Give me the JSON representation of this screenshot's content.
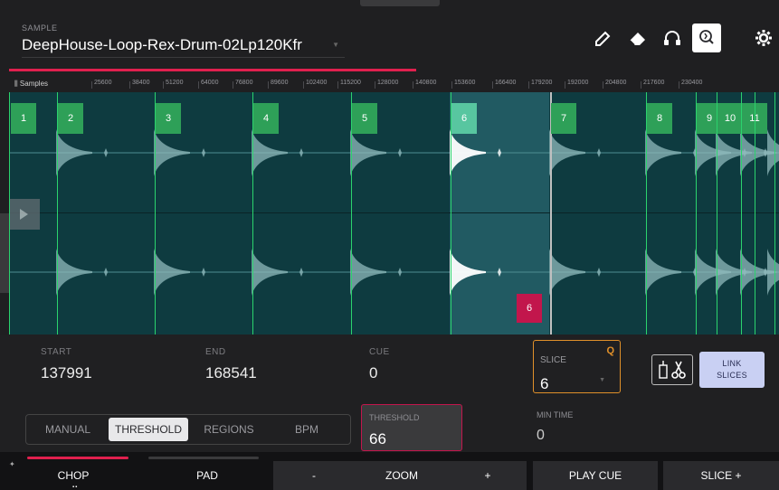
{
  "header": {
    "caption": "SAMPLE",
    "sample_name": "DeepHouse-Loop-Rex-Drum-02Lp120Kfr",
    "tools": [
      "pencil-icon",
      "eraser-icon",
      "headphones-icon",
      "zoom-icon",
      "settings-gear-icon"
    ]
  },
  "ruler": {
    "label": "Samples",
    "ticks": [
      "25600",
      "38400",
      "51200",
      "64000",
      "76800",
      "89600",
      "102400",
      "115200",
      "128000",
      "140800",
      "153600",
      "166400",
      "179200",
      "192000",
      "204800",
      "217600",
      "230400"
    ]
  },
  "slices": [
    "1",
    "2",
    "3",
    "4",
    "5",
    "6",
    "7",
    "8",
    "9",
    "10",
    "11"
  ],
  "selected_slice_end_marker": "6",
  "params": {
    "start_label": "START",
    "start_value": "137991",
    "end_label": "END",
    "end_value": "168541",
    "cue_label": "CUE",
    "cue_value": "0",
    "slice_label": "SLICE",
    "slice_value": "6",
    "slice_q": "Q",
    "link_label_1": "LINK",
    "link_label_2": "SLICES"
  },
  "modes": {
    "items": [
      "MANUAL",
      "THRESHOLD",
      "REGIONS",
      "BPM"
    ],
    "active": "THRESHOLD",
    "threshold_label": "THRESHOLD",
    "threshold_value": "66",
    "mintime_label": "MIN TIME",
    "mintime_value": "0"
  },
  "bottom": {
    "chop": "CHOP",
    "pad": "PAD",
    "minus": "-",
    "zoom": "ZOOM",
    "plus": "+",
    "play_cue": "PLAY CUE",
    "slice_plus": "SLICE +"
  },
  "colors": {
    "accent": "#e0204e",
    "slice_green": "#2ea058",
    "waveform_bg": "#0e3b40",
    "orange": "#e0902a",
    "link_blue": "#c9d0f3"
  }
}
